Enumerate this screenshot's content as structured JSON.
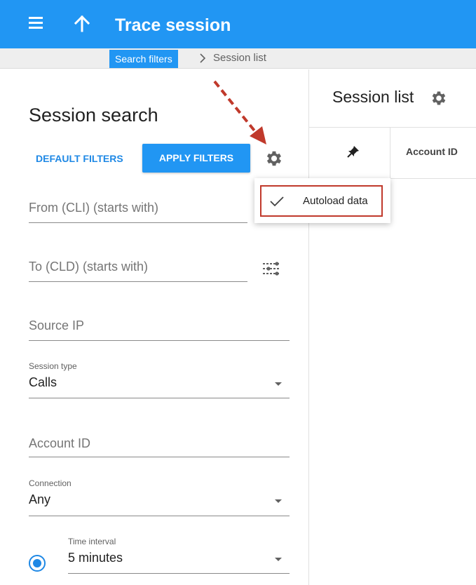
{
  "appbar": {
    "title": "Trace session",
    "menu_icon": "hamburger-menu-icon",
    "up_icon": "arrow-up-icon",
    "color": "#2196f3"
  },
  "breadcrumb": {
    "active": "Search filters",
    "separator_icon": "chevron-right-icon",
    "next": "Session list"
  },
  "search_panel": {
    "title": "Session search",
    "default_filters_label": "DEFAULT FILTERS",
    "apply_filters_label": "APPLY FILTERS",
    "settings_icon": "gear-icon",
    "fields": {
      "from_cli": {
        "placeholder": "From (CLI) (starts with)"
      },
      "to_cld": {
        "placeholder": "To (CLD) (starts with)",
        "icon": "tune-icon"
      },
      "source_ip": {
        "placeholder": "Source IP"
      },
      "session_type": {
        "label": "Session type",
        "value": "Calls"
      },
      "account_id": {
        "placeholder": "Account ID"
      },
      "connection": {
        "label": "Connection",
        "value": "Any"
      },
      "time_interval": {
        "label": "Time interval",
        "value": "5 minutes",
        "selected": true
      }
    }
  },
  "session_list": {
    "title": "Session list",
    "settings_icon": "gear-icon",
    "columns": [
      {
        "icon": "pin-icon"
      },
      {
        "label": "Account ID"
      }
    ]
  },
  "settings_menu": {
    "items": [
      {
        "label": "Autoload data",
        "checked": true,
        "check_icon": "checkmark-icon"
      }
    ],
    "highlight_color": "#c0392b"
  },
  "annotation": {
    "arrow_color": "#c0392b"
  }
}
